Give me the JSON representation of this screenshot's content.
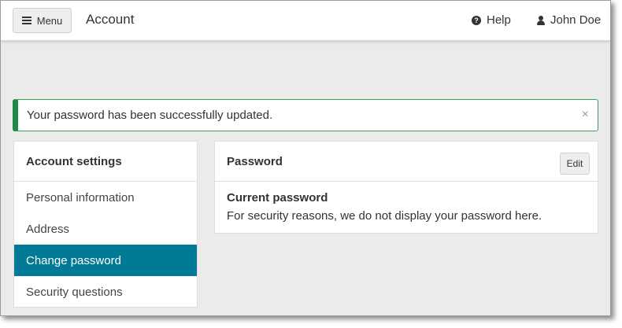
{
  "header": {
    "menu_label": "Menu",
    "page_title": "Account",
    "help_label": "Help",
    "user_name": "John Doe",
    "icons": {
      "menu": "hamburger-icon",
      "help": "question-circle-icon",
      "user": "user-icon"
    }
  },
  "alert": {
    "message": "Your password has been successfully updated.",
    "close_glyph": "×",
    "color": "#1f8a43"
  },
  "sidebar": {
    "heading": "Account settings",
    "items": [
      {
        "label": "Personal information",
        "active": false
      },
      {
        "label": "Address",
        "active": false
      },
      {
        "label": "Change password",
        "active": true
      },
      {
        "label": "Security questions",
        "active": false
      }
    ],
    "active_color": "#007a96"
  },
  "password_panel": {
    "heading": "Password",
    "edit_label": "Edit",
    "field_label": "Current password",
    "field_text": "For security reasons, we do not display your password here."
  }
}
